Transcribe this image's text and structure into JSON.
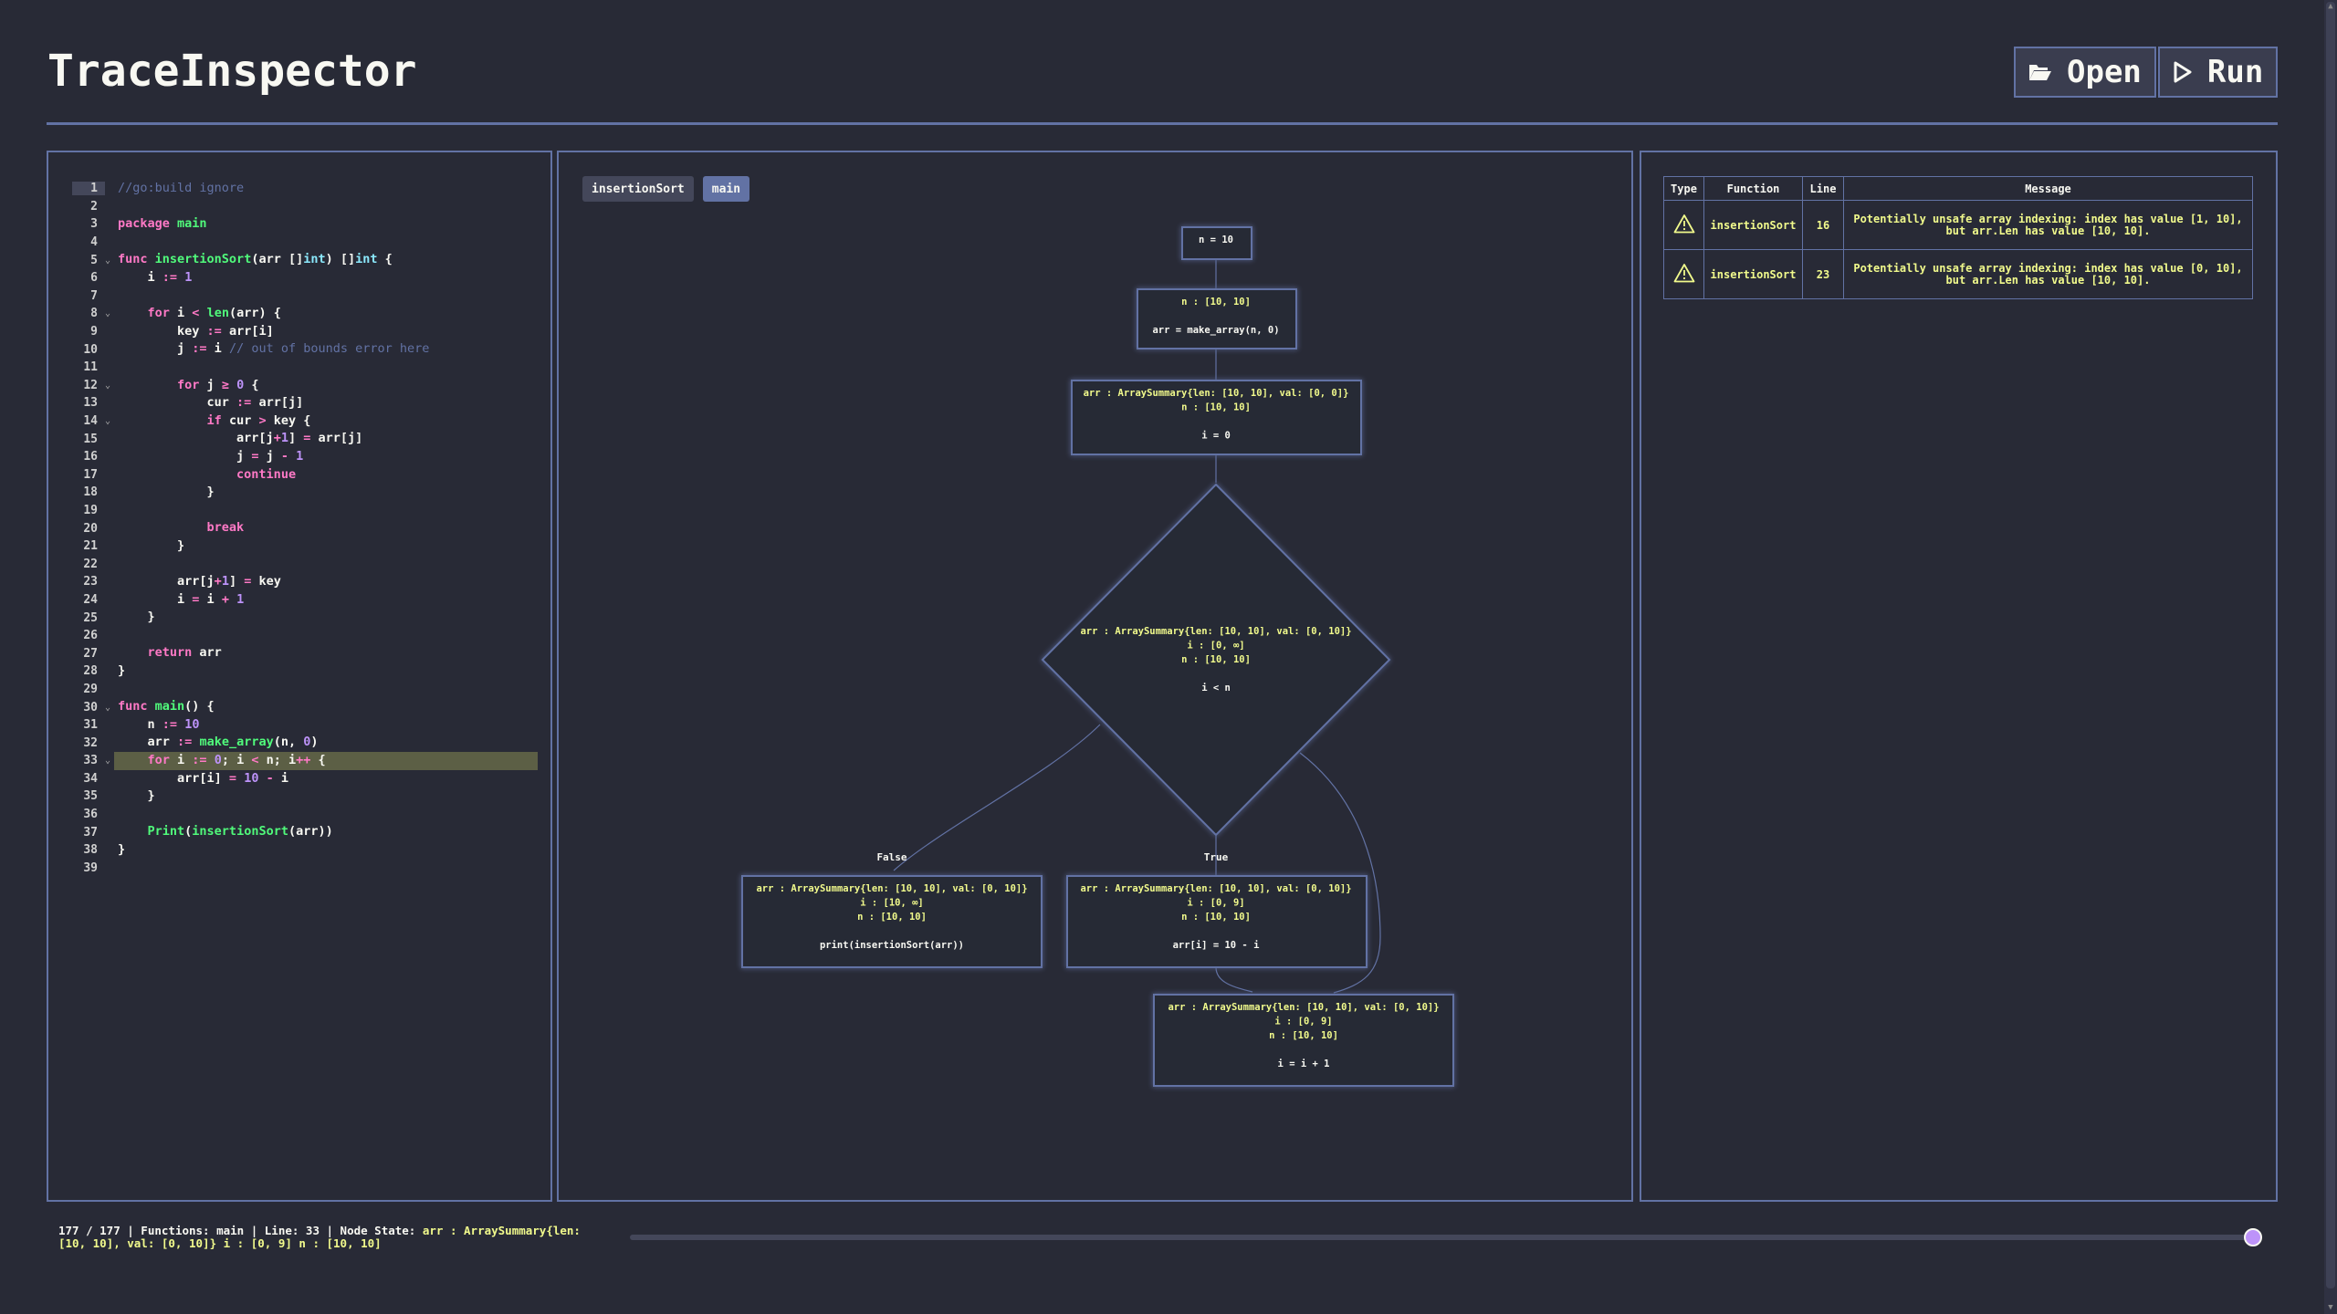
{
  "app": {
    "title": "TraceInspector"
  },
  "toolbar": {
    "open_label": "Open",
    "run_label": "Run",
    "open_icon": "folder-open-icon",
    "run_icon": "play-icon"
  },
  "code": {
    "current_line": 1,
    "exec_line": 33,
    "lines": [
      "//go:build ignore",
      "",
      "package main",
      "",
      "func insertionSort(arr []int) []int {",
      "    i := 1",
      "",
      "    for i < len(arr) {",
      "        key := arr[i]",
      "        j := i // out of bounds error here",
      "",
      "        for j ≥ 0 {",
      "            cur := arr[j]",
      "            if cur > key {",
      "                arr[j+1] = arr[j]",
      "                j = j - 1",
      "                continue",
      "            }",
      "",
      "            break",
      "        }",
      "",
      "        arr[j+1] = key",
      "        i = i + 1",
      "    }",
      "",
      "    return arr",
      "}",
      "",
      "func main() {",
      "    n := 10",
      "    arr := make_array(n, 0)",
      "    for i := 0; i < n; i++ {",
      "        arr[i] = 10 - i",
      "    }",
      "",
      "    Print(insertionSort(arr))",
      "}",
      ""
    ],
    "fold_lines": [
      5,
      8,
      12,
      14,
      30,
      33
    ]
  },
  "cfg": {
    "tabs": [
      {
        "label": "insertionSort",
        "active": false
      },
      {
        "label": "main",
        "active": true
      }
    ],
    "nodes": {
      "n1": {
        "state": [],
        "code": "n = 10"
      },
      "n2": {
        "state": [
          "n : [10, 10]"
        ],
        "code": "arr = make_array(n, 0)"
      },
      "n3": {
        "state": [
          "arr : ArraySummary{len: [10, 10], val: [0, 0]}",
          "n : [10, 10]"
        ],
        "code": "i = 0"
      },
      "cond": {
        "state": [
          "arr : ArraySummary{len: [10, 10], val: [0, 10]}",
          "i : [0, ∞]",
          "n : [10, 10]"
        ],
        "code": "i < n"
      },
      "nf": {
        "state": [
          "arr : ArraySummary{len: [10, 10], val: [0, 10]}",
          "i : [10, ∞]",
          "n : [10, 10]"
        ],
        "code": "print(insertionSort(arr))"
      },
      "nt": {
        "state": [
          "arr : ArraySummary{len: [10, 10], val: [0, 10]}",
          "i : [0, 9]",
          "n : [10, 10]"
        ],
        "code": "arr[i] = 10 - i"
      },
      "ni": {
        "state": [
          "arr : ArraySummary{len: [10, 10], val: [0, 10]}",
          "i : [0, 9]",
          "n : [10, 10]"
        ],
        "code": "i = i + 1"
      }
    },
    "labels": {
      "false": "False",
      "true": "True"
    }
  },
  "diagnostics": {
    "headers": [
      "Type",
      "Function",
      "Line",
      "Message"
    ],
    "rows": [
      {
        "type_icon": "warning-icon",
        "function": "insertionSort",
        "line": "16",
        "message": "Potentially unsafe array indexing: index has value [1, 10], but arr.Len has value [10, 10]."
      },
      {
        "type_icon": "warning-icon",
        "function": "insertionSort",
        "line": "23",
        "message": "Potentially unsafe array indexing: index has value [0, 10], but arr.Len has value [10, 10]."
      }
    ]
  },
  "status": {
    "prefix": "177 / 177 | Functions: main | Line: 33 | Node State: ",
    "state": "arr : ArraySummary{len: [10, 10], val: [0, 10]} i : [0, 9] n : [10, 10]",
    "progress": 1.0
  },
  "colors": {
    "background": "#282a36",
    "border": "#6272a4",
    "state_text": "#f1fa8c",
    "exec_highlight": "#5c5f45",
    "accent": "#bd93f9"
  }
}
